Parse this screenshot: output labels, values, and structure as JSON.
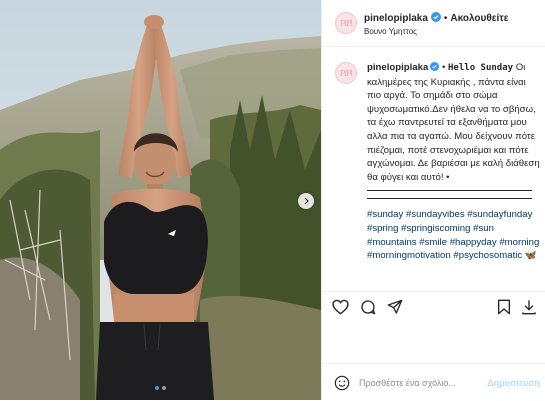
{
  "post": {
    "username": "pinelopiplaka",
    "follow_separator": "•",
    "follow_label": "Ακολουθείτε",
    "location": "Βουνο Υμηττος",
    "avatar_text": "PiPl"
  },
  "caption": {
    "username": "pinelopiplaka",
    "separator": "•",
    "hello": "Hello Sunday",
    "text": "Οι καλημέρες της Κυριακής , πάντα είναι πιο αργά. Το σημάδι στο σώμα ψυχοσωματικό.Δεν ήθελα να το σβήσω, τα έχω παντρευτεί τα εξανθήματα μου αλλα πια τα αγαπώ. Μου δείχνουν πότε πιέζομαι, ποτέ στενοχωριέμαι και πότε αγχώνομαι. Δε βαριέσαι με καλή διάθεση θα φύγει και αυτό! •",
    "hashtags": [
      "#sunday",
      "#sundayvibes",
      "#sundayfunday",
      "#spring",
      "#springiscoming",
      "#sun",
      "#mountains",
      "#smile",
      "#happyday",
      "#morning",
      "#morningmotivation",
      "#psychosomatic"
    ],
    "trailing_emoji": "🦋"
  },
  "actions": {
    "like_icon": "heart-icon",
    "comment_icon": "comment-icon",
    "share_icon": "paper-plane-icon",
    "save_icon": "bookmark-icon",
    "download_icon": "download-icon"
  },
  "comment": {
    "emoji_icon": "smiley-icon",
    "placeholder": "Προσθέστε ένα σχόλιο...",
    "post_label": "Δημοσίευση"
  },
  "carousel": {
    "dot_count": 2,
    "active_index": 0
  },
  "colors": {
    "verified": "#3897f0",
    "link": "#00376b",
    "post_disabled": "#b2dffc",
    "border": "#efefef"
  }
}
